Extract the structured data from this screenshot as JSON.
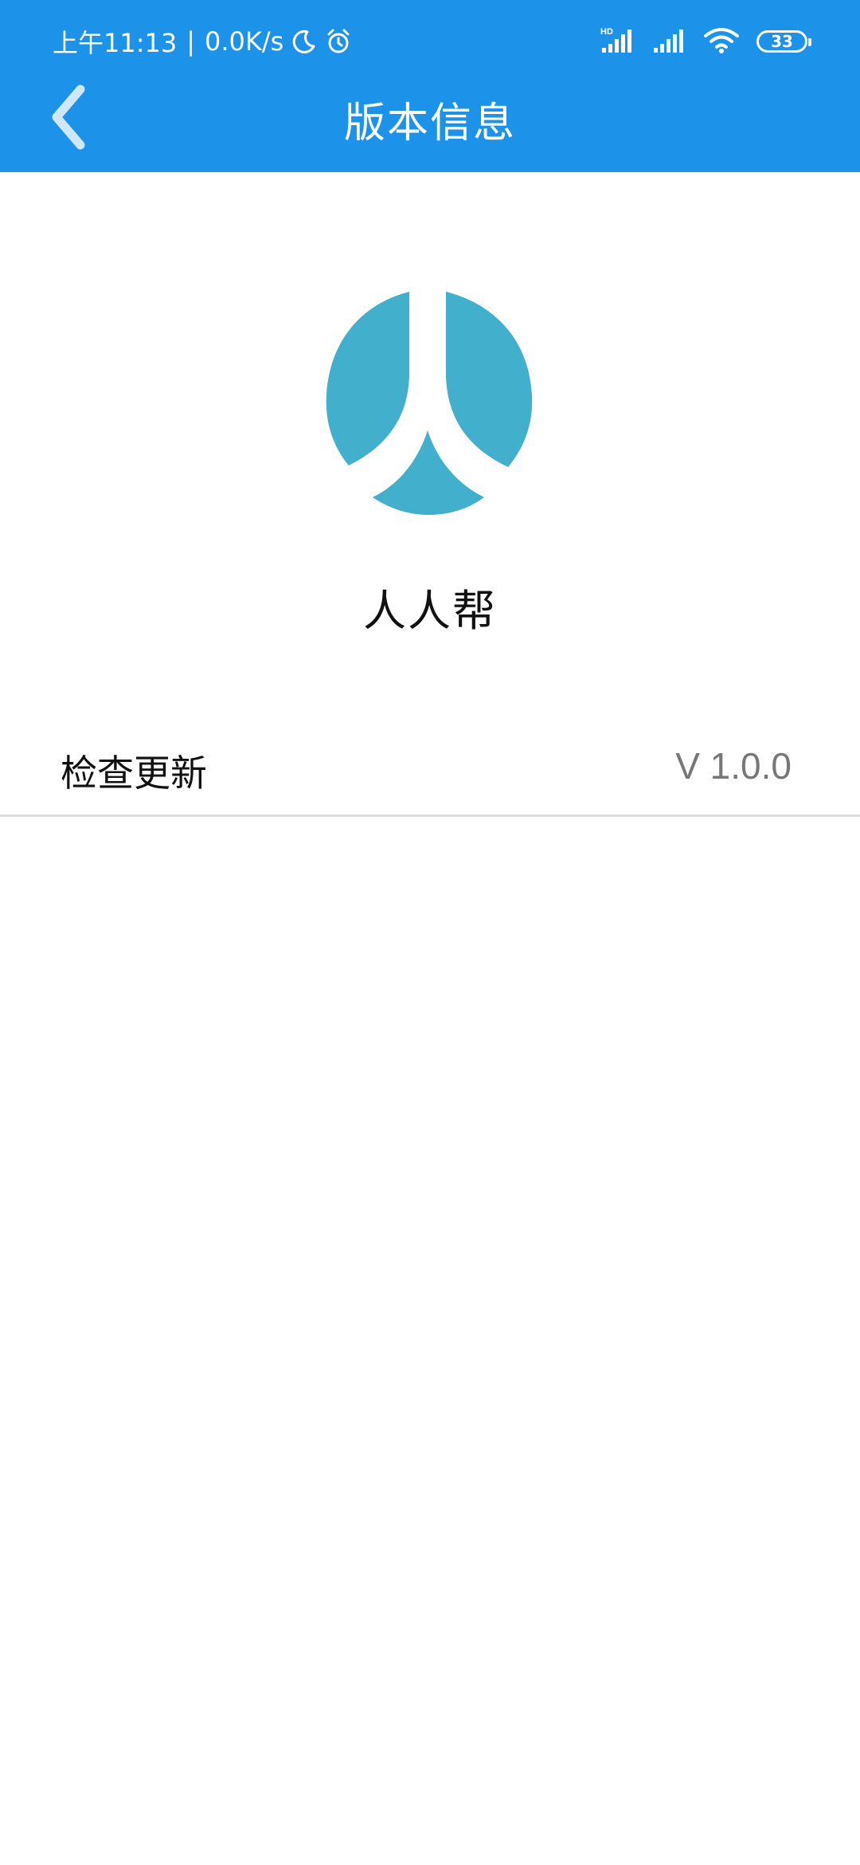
{
  "status_bar": {
    "time": "上午11:13",
    "separator": "|",
    "network_speed": "0.0K/s",
    "icons_left": [
      "moon-icon",
      "alarm-icon"
    ],
    "network_badge": "HD",
    "icons_right": [
      "hd-signal-icon",
      "signal-icon",
      "wifi-icon"
    ],
    "battery_level": "33"
  },
  "toolbar": {
    "title": "版本信息",
    "back_icon": "chevron-left-icon"
  },
  "app": {
    "name": "人人帮",
    "logo_color": "#42b0cd"
  },
  "update_row": {
    "label": "检查更新",
    "version": "V 1.0.0"
  },
  "colors": {
    "accent": "#1c93e8",
    "background": "#ffffff",
    "divider": "#dcdcdc",
    "secondary_text": "#777777"
  }
}
